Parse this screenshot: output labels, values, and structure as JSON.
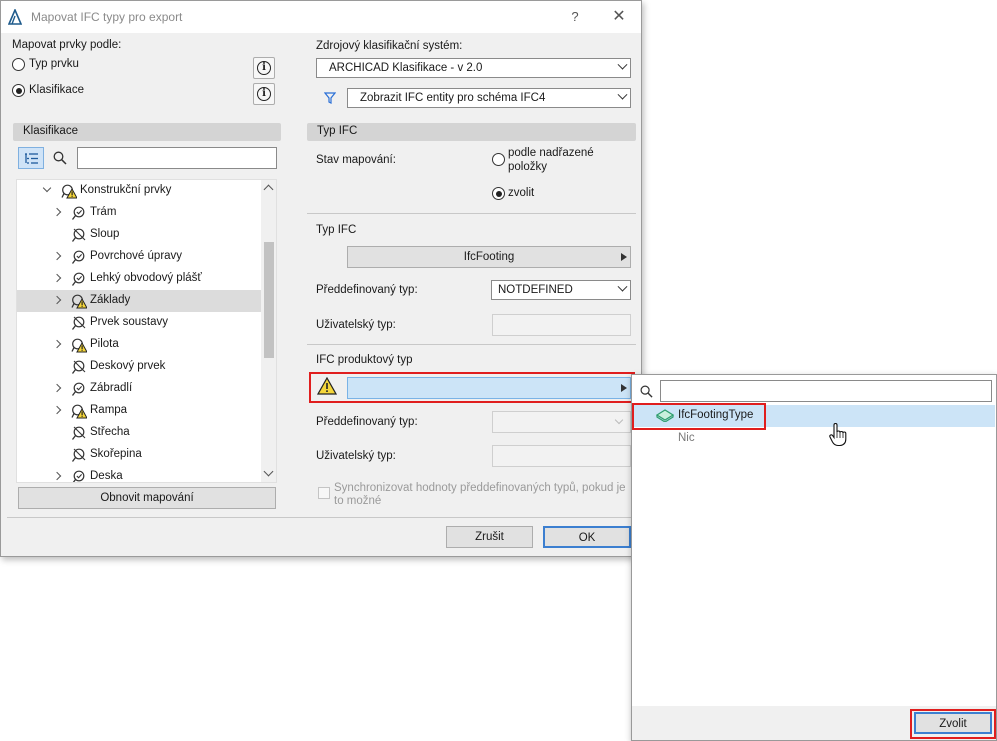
{
  "window": {
    "title": "Mapovat IFC typy pro export",
    "help": "?",
    "close": "✕"
  },
  "left": {
    "map_by_label": "Mapovat prvky podle:",
    "radio_type": "Typ prvku",
    "radio_classification": "Klasifikace",
    "selected": "Klasifikace",
    "info_glyph": "i",
    "tree_header": "Klasifikace",
    "search_placeholder": "",
    "tree": [
      {
        "label": "Konstrukční prvky",
        "level": 1,
        "expander": "open",
        "icon": "warning-icon",
        "selected": false
      },
      {
        "label": "Trám",
        "level": 2,
        "expander": "closed",
        "icon": "mapped-icon",
        "selected": false
      },
      {
        "label": "Sloup",
        "level": 2,
        "expander": "none",
        "icon": "unmapped-icon",
        "selected": false
      },
      {
        "label": "Povrchové úpravy",
        "level": 2,
        "expander": "closed",
        "icon": "mapped-icon",
        "selected": false
      },
      {
        "label": "Lehký obvodový plášť",
        "level": 2,
        "expander": "closed",
        "icon": "mapped-icon",
        "selected": false
      },
      {
        "label": "Základy",
        "level": 2,
        "expander": "closed",
        "icon": "warning-icon",
        "selected": true
      },
      {
        "label": "Prvek soustavy",
        "level": 2,
        "expander": "none",
        "icon": "unmapped-icon",
        "selected": false
      },
      {
        "label": "Pilota",
        "level": 2,
        "expander": "closed",
        "icon": "warning-icon",
        "selected": false
      },
      {
        "label": "Deskový prvek",
        "level": 2,
        "expander": "none",
        "icon": "unmapped-icon",
        "selected": false
      },
      {
        "label": "Zábradlí",
        "level": 2,
        "expander": "closed",
        "icon": "mapped-icon",
        "selected": false
      },
      {
        "label": "Rampa",
        "level": 2,
        "expander": "closed",
        "icon": "warning-icon",
        "selected": false
      },
      {
        "label": "Střecha",
        "level": 2,
        "expander": "none",
        "icon": "unmapped-icon",
        "selected": false
      },
      {
        "label": "Skořepina",
        "level": 2,
        "expander": "none",
        "icon": "unmapped-icon",
        "selected": false
      },
      {
        "label": "Deska",
        "level": 2,
        "expander": "closed",
        "icon": "mapped-icon",
        "selected": false
      }
    ],
    "refresh_button": "Obnovit mapování"
  },
  "right": {
    "source_system_label": "Zdrojový klasifikační systém:",
    "source_system_value": "ARCHICAD Klasifikace - v 2.0",
    "filter_value": "Zobrazit IFC entity pro schéma IFC4",
    "ifc_type_header": "Typ IFC",
    "mapping_state_label": "Stav mapování:",
    "radio_parent_line1": "podle nadřazené",
    "radio_parent_line2": "položky",
    "radio_choose": "zvolit",
    "selected_state": "zvolit",
    "ifc_type_label": "Typ IFC",
    "ifc_type_value": "IfcFooting",
    "predef_label": "Předdefinovaný typ:",
    "predef_value": "NOTDEFINED",
    "user_type_label": "Uživatelský typ:",
    "user_type_value": "",
    "product_type_label": "IFC produktový typ",
    "product_type_value": "",
    "predef2_label": "Předdefinovaný typ:",
    "user_type2_label": "Uživatelský typ:",
    "sync_line1": "Synchronizovat hodnoty předdefinovaných typů, pokud je",
    "sync_line2": "to možné",
    "sync_checked": false
  },
  "footer": {
    "cancel": "Zrušit",
    "ok": "OK"
  },
  "popup": {
    "search_placeholder": "",
    "items": [
      {
        "label": "IfcFootingType",
        "highlighted": true
      },
      {
        "label": "Nic",
        "highlighted": false
      }
    ],
    "choose_button": "Zvolit"
  },
  "colors": {
    "highlight_red": "#e01e1e",
    "selection_blue": "#cce4f7",
    "ifc_green": "#2e9e6e",
    "warning_yellow": "#f5d63a"
  }
}
